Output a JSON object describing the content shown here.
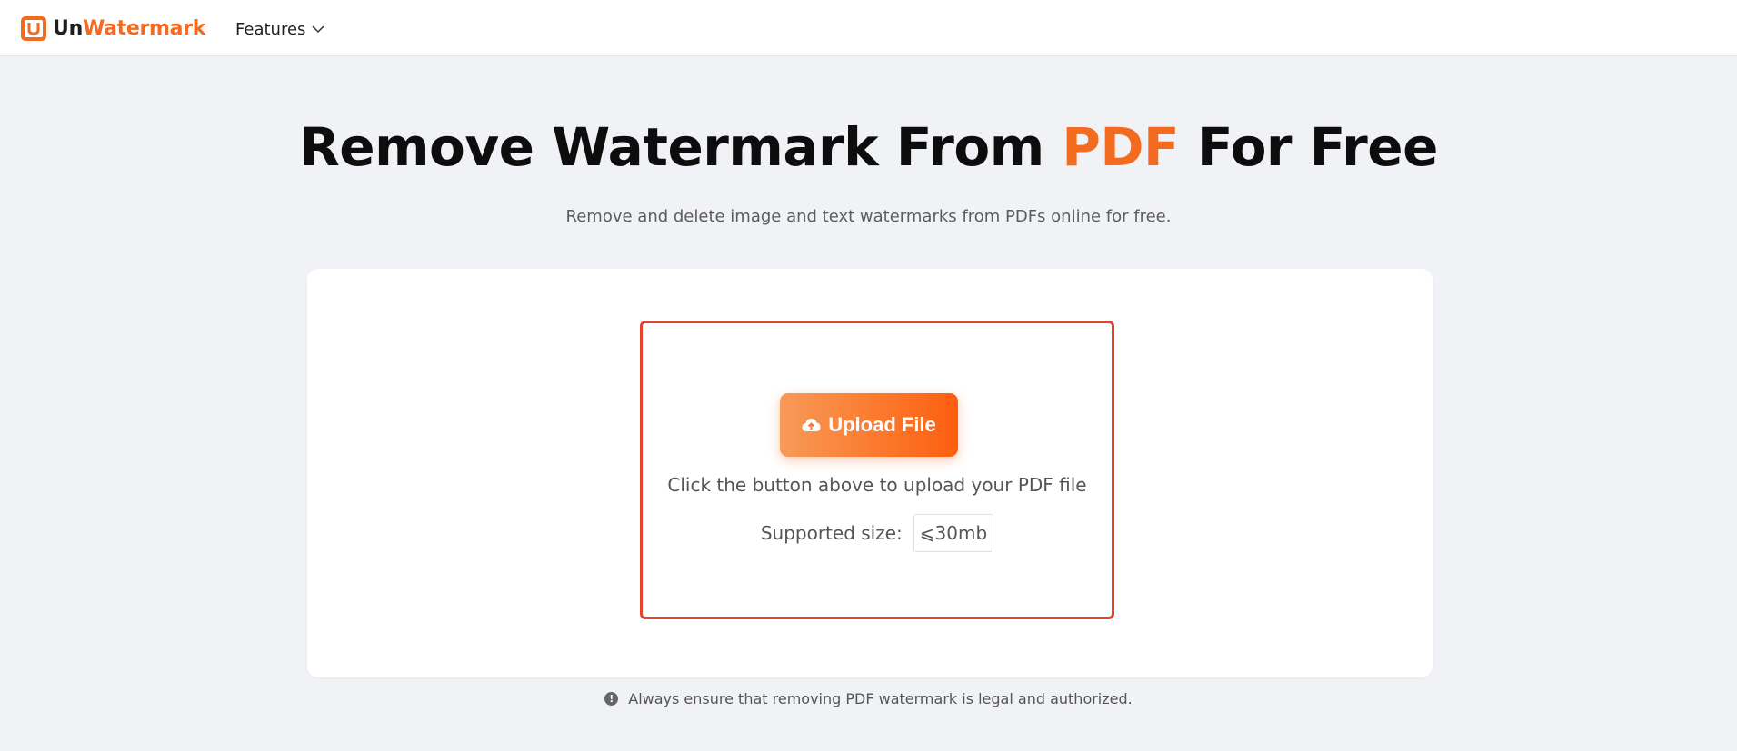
{
  "header": {
    "logo_prefix": "Un",
    "logo_suffix": "Watermark",
    "nav_features": "Features",
    "brand_color": "#f36b21"
  },
  "hero": {
    "title_before": "Remove Watermark From ",
    "title_accent": "PDF",
    "title_after": " For Free",
    "subtitle": "Remove and delete image and text watermarks from PDFs online for free."
  },
  "upload": {
    "button_label": "Upload File",
    "button_icon": "cloud-upload-icon",
    "hint": "Click the button above to upload your PDF file",
    "size_label": "Supported size:",
    "size_value": "⩽30mb",
    "dropzone_border_color": "#e5432b"
  },
  "notice": {
    "icon": "exclamation-circle-icon",
    "text": "Always ensure that removing PDF watermark is legal and authorized."
  }
}
